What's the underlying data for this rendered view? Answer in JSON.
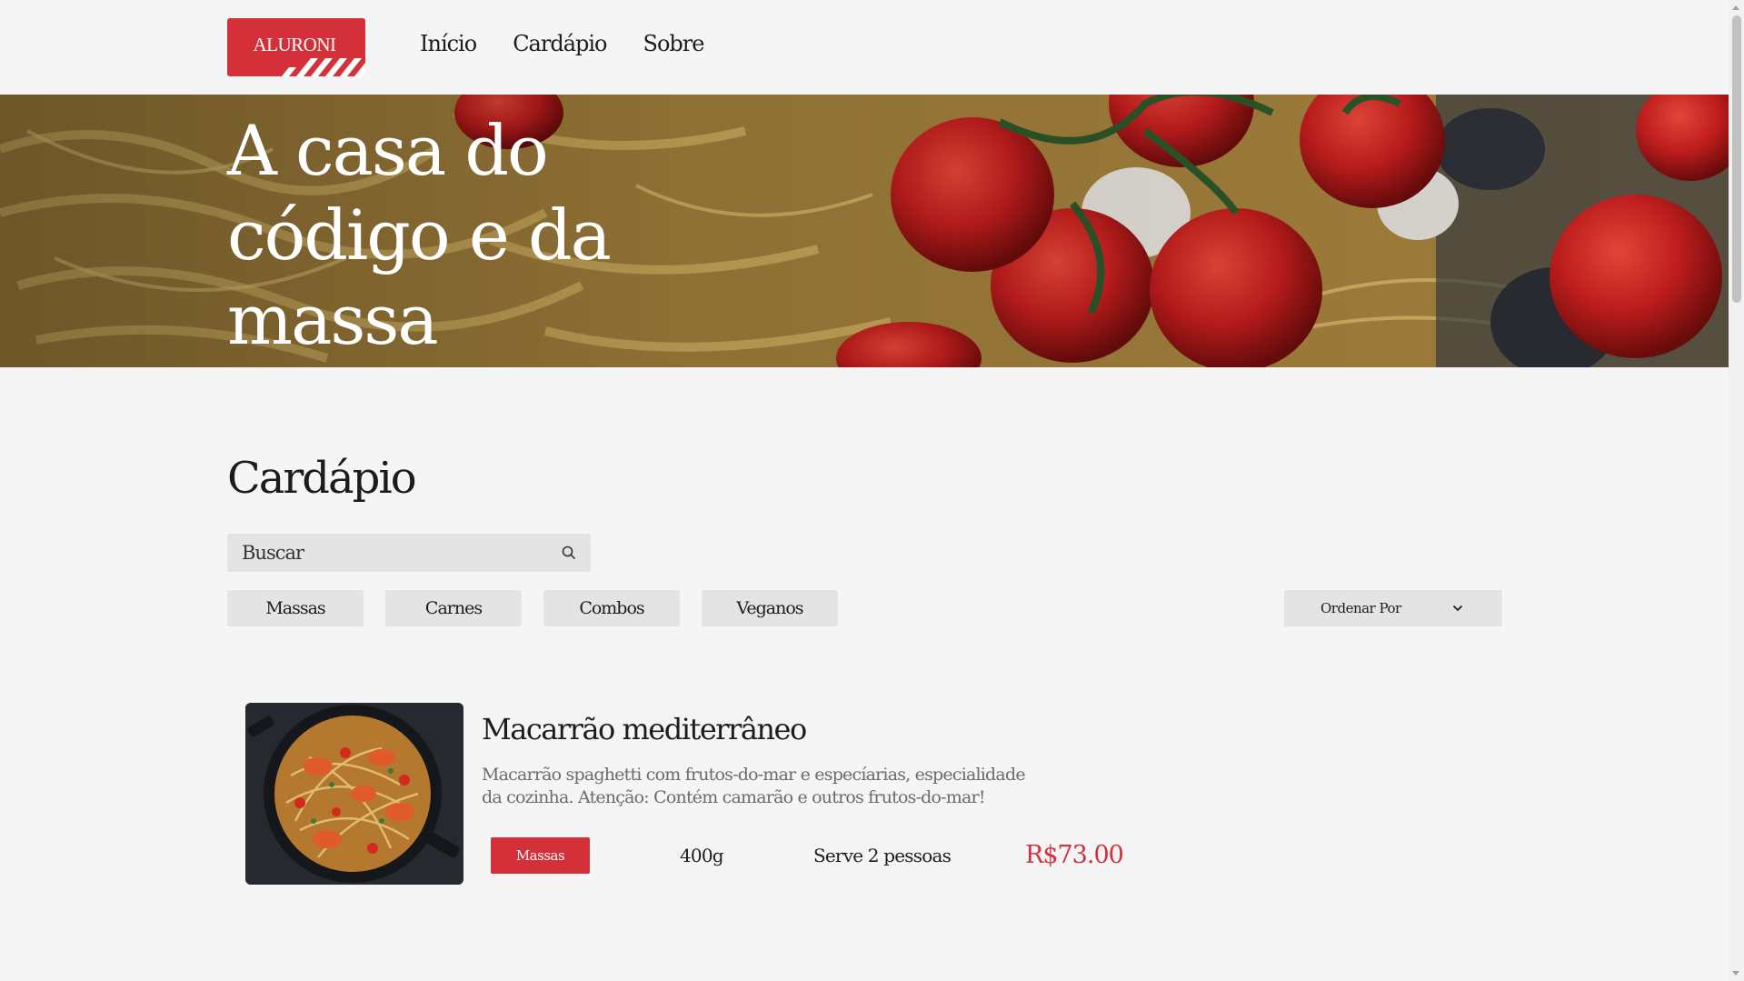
{
  "brand": {
    "logo_text": "ALURONI",
    "accent_color": "#d3303a"
  },
  "nav": {
    "items": [
      {
        "label": "Início"
      },
      {
        "label": "Cardápio"
      },
      {
        "label": "Sobre"
      }
    ]
  },
  "hero": {
    "title": "A casa do código e da massa"
  },
  "menu": {
    "title": "Cardápio",
    "search": {
      "placeholder": "Buscar",
      "icon": "search-icon"
    },
    "filters": [
      {
        "label": "Massas"
      },
      {
        "label": "Carnes"
      },
      {
        "label": "Combos"
      },
      {
        "label": "Veganos"
      }
    ],
    "sort": {
      "label": "Ordenar Por",
      "icon": "chevron-down-icon"
    },
    "items": [
      {
        "name": "Macarrão mediterrâneo",
        "description": "Macarrão spaghetti com frutos-do-mar e especíarias, especialidade da cozinha. Atenção: Contém camarão e outros frutos-do-mar!",
        "category": "Massas",
        "weight": "400g",
        "serves": "Serve 2 pessoas",
        "price": "R$73.00"
      }
    ]
  }
}
